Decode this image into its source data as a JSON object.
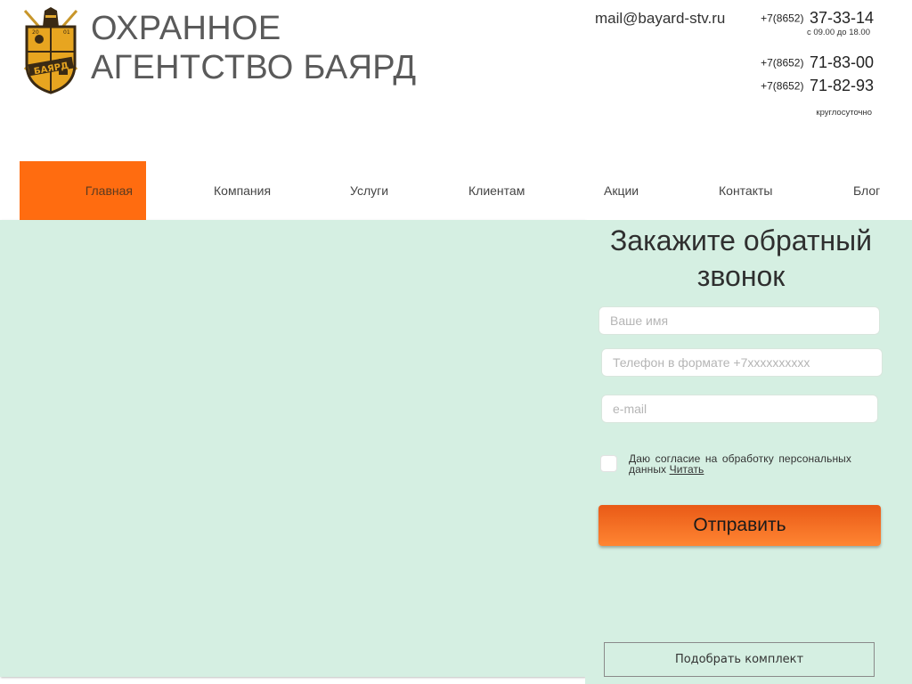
{
  "header": {
    "logo_text": "БАЯРД",
    "logo_years": [
      "20",
      "01"
    ],
    "title_line1": "ОХРАННОЕ",
    "title_line2": "АГЕНТСТВО БАЯРД",
    "email": "mail@bayard-stv.ru",
    "phones": [
      {
        "code": "+7(8652)",
        "number": "37-33-14"
      },
      {
        "code": "+7(8652)",
        "number": "71-83-00"
      },
      {
        "code": "+7(8652)",
        "number": "71-82-93"
      }
    ],
    "hours_day": "с 09.00 до 18.00",
    "hours_round": "круглосуточно"
  },
  "nav": {
    "items": [
      "Главная",
      "Компания",
      "Услуги",
      "Клиентам",
      "Акции",
      "Контакты",
      "Блог"
    ],
    "active": 0,
    "accent_color": "#ff6c10"
  },
  "form": {
    "title_line1": "Закажите обратный",
    "title_line2": "звонок",
    "name_placeholder": "Ваше имя",
    "phone_placeholder": "Телефон в формате +7xxxxxxxxxx",
    "email_placeholder": "e-mail",
    "consent_text": "Даю согласие на обработку персональных данных",
    "consent_link": "Читать",
    "submit_label": "Отправить",
    "kit_label": "Подобрать комплект",
    "background_color": "#d5efe2"
  }
}
